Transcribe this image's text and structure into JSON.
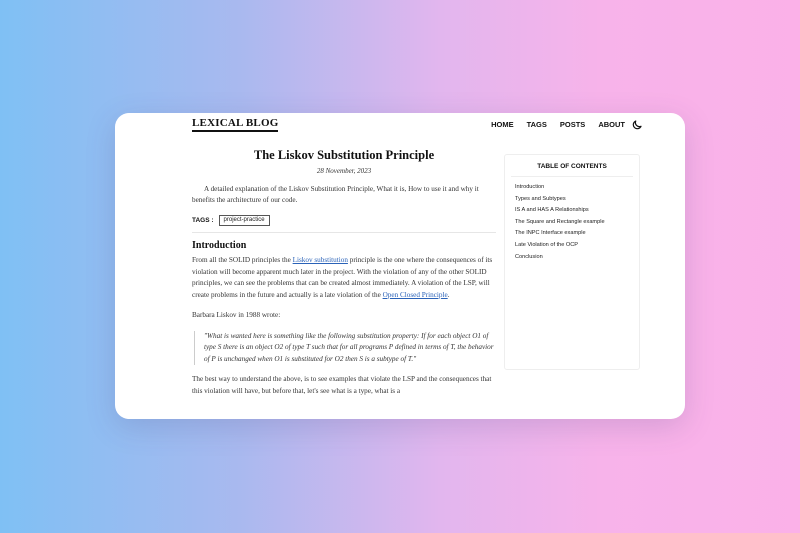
{
  "site": {
    "logo": "LEXICAL BLOG"
  },
  "nav": {
    "items": [
      "HOME",
      "TAGS",
      "POSTS",
      "ABOUT"
    ],
    "theme_icon": "moon-icon"
  },
  "article": {
    "title": "The Liskov Substitution Principle",
    "date": "28 November, 2023",
    "summary": "A detailed explanation of the Liskov Substitution Principle, What it is, How to use it and why it benefits the architecture of our code.",
    "tags_label": "TAGS :",
    "tags": [
      "project-practice"
    ],
    "section_heading": "Introduction",
    "para1": {
      "text_a": "From all the SOLID principles the ",
      "link_a": "Liskov substitution",
      "text_b": " principle is the one where the consequences of its violation will become apparent much later in the project. With the violation of any of the other SOLID principles, we can see the problems that can be created almost immediately. A violation of the LSP, will create problems in the future and actually is a late violation of the ",
      "link_b": "Open Closed Principle",
      "text_c": "."
    },
    "para2": "Barbara Liskov in 1988 wrote:",
    "quote": "\"What is wanted here is something like the following substitution property: If for each object O1 of type S there is an object O2 of type T such that for all programs P defined in terms of T, the behavior of P is unchanged when O1 is substituted for O2 then S is a subtype of T.\"",
    "para3": "The best way to understand the above, is to see examples that violate the LSP and the consequences that this violation will have, but before that, let's see what is a type, what is a"
  },
  "toc": {
    "title": "TABLE OF CONTENTS",
    "items": [
      "Introduction",
      "Types and Subtypes",
      "IS A and HAS A Relationships",
      "The Square and Rectangle example",
      "The INPC Interface example",
      "Late Violation of the OCP",
      "Conclusion"
    ]
  }
}
